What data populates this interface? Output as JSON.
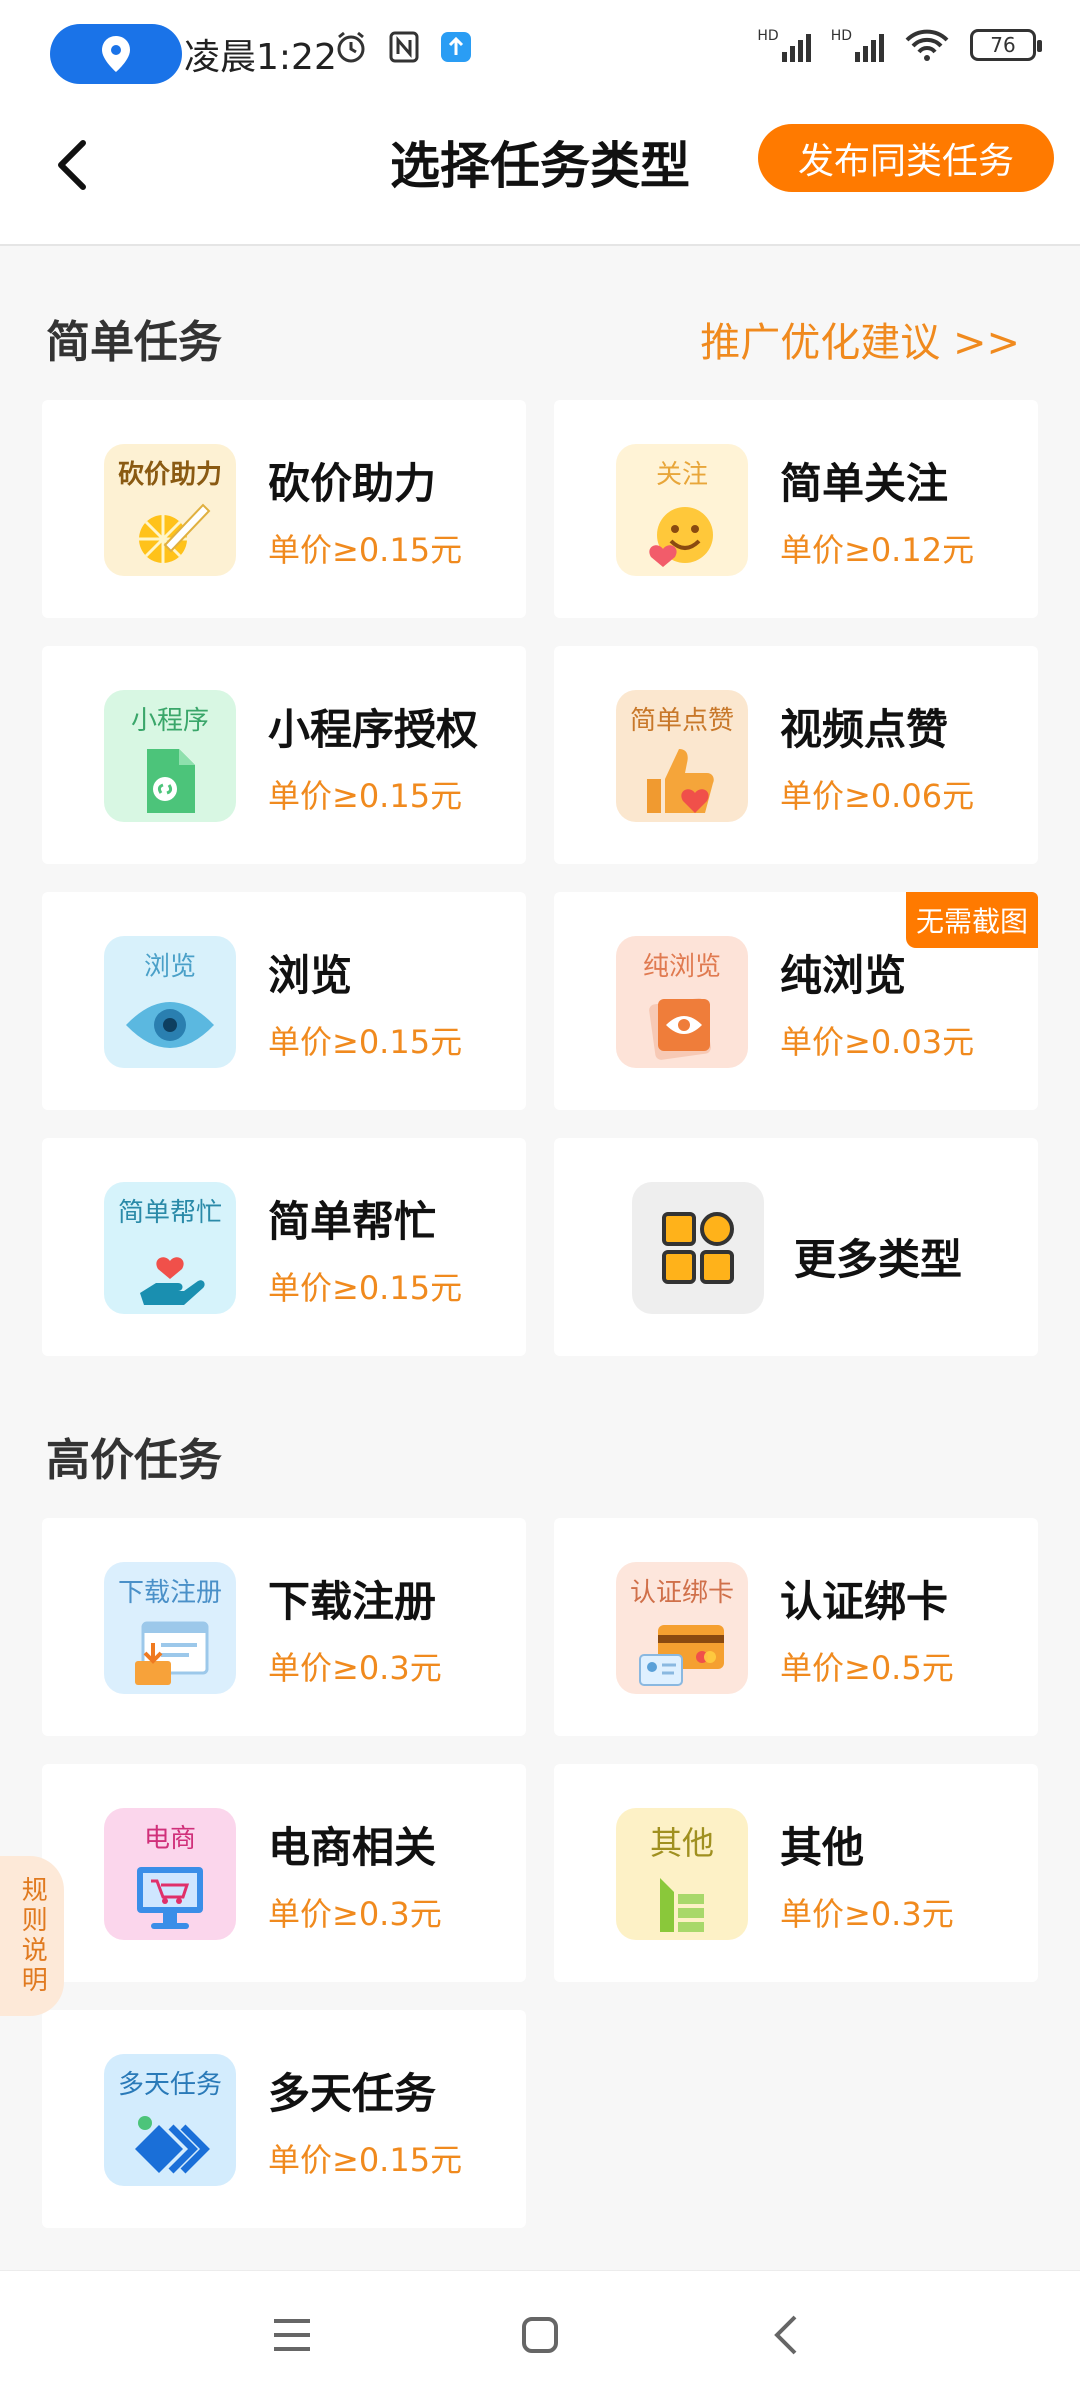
{
  "status_bar": {
    "time": "凌晨1:22",
    "battery": "76",
    "signal1": "HD",
    "signal2": "HD"
  },
  "header": {
    "title": "选择任务类型",
    "publish_label": "发布同类任务"
  },
  "simple_section": {
    "title": "简单任务",
    "promo_link": "推广优化建议 >>",
    "cards": [
      {
        "name": "砍价助力",
        "price": "单价≥0.15元",
        "icon_label": "砍价助力",
        "icon": "bargain-icon"
      },
      {
        "name": "简单关注",
        "price": "单价≥0.12元",
        "icon_label": "关注",
        "icon": "follow-icon"
      },
      {
        "name": "小程序授权",
        "price": "单价≥0.15元",
        "icon_label": "小程序",
        "icon": "mini-program-icon"
      },
      {
        "name": "视频点赞",
        "price": "单价≥0.06元",
        "icon_label": "简单点赞",
        "icon": "thumbs-up-icon"
      },
      {
        "name": "浏览",
        "price": "单价≥0.15元",
        "icon_label": "浏览",
        "icon": "eye-icon"
      },
      {
        "name": "纯浏览",
        "price": "单价≥0.03元",
        "icon_label": "纯浏览",
        "icon": "eye-card-icon",
        "badge": "无需截图"
      },
      {
        "name": "简单帮忙",
        "price": "单价≥0.15元",
        "icon_label": "简单帮忙",
        "icon": "helping-hand-icon"
      }
    ],
    "more_label": "更多类型"
  },
  "high_section": {
    "title": "高价任务",
    "cards": [
      {
        "name": "下载注册",
        "price": "单价≥0.3元",
        "icon_label": "下载注册",
        "icon": "download-register-icon"
      },
      {
        "name": "认证绑卡",
        "price": "单价≥0.5元",
        "icon_label": "认证绑卡",
        "icon": "bank-card-icon"
      },
      {
        "name": "电商相关",
        "price": "单价≥0.3元",
        "icon_label": "电商",
        "icon": "shopping-cart-icon"
      },
      {
        "name": "其他",
        "price": "单价≥0.3元",
        "icon_label": "其他",
        "icon": "other-icon"
      },
      {
        "name": "多天任务",
        "price": "单价≥0.15元",
        "icon_label": "多天任务",
        "icon": "multi-day-icon"
      }
    ]
  },
  "rule_tab": {
    "label": "规则说明"
  },
  "colors": {
    "accent": "#ff7a00",
    "price": "#f08a1e"
  }
}
